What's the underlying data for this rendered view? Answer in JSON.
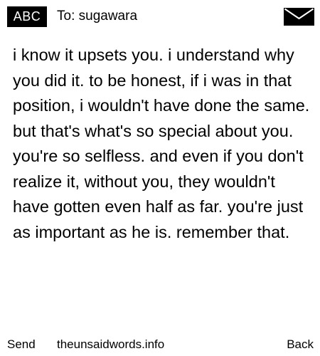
{
  "header": {
    "badge": "ABC",
    "recipient": "To: sugawara",
    "icon": "envelope-icon"
  },
  "message": {
    "body": "i know it upsets you. i understand why you did it. to be honest, if i was in that position, i wouldn't have done the same. but that's what's so special about you. you're so selfless. and even if you don't realize it, without you, they wouldn't have gotten even half as far. you're just as important as he is. remember that."
  },
  "footer": {
    "send_label": "Send",
    "site": "theunsaidwords.info",
    "back_label": "Back"
  }
}
